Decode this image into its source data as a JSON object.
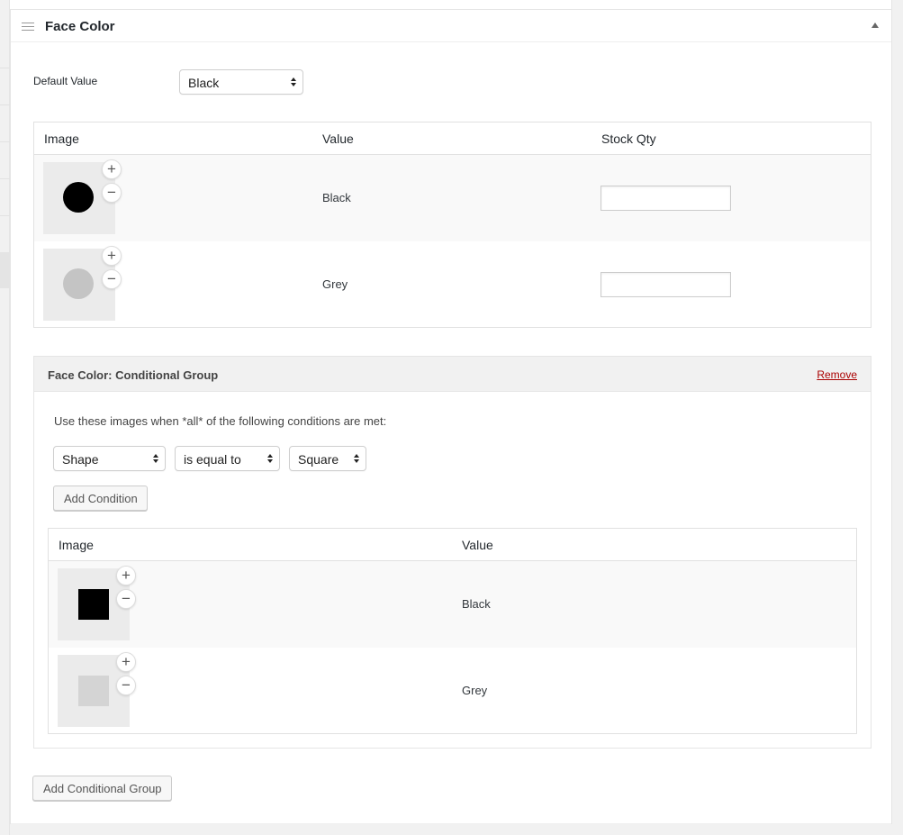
{
  "panel": {
    "title": "Face Color",
    "default_value_label": "Default Value",
    "default_value_selected": "Black"
  },
  "options_table": {
    "headers": {
      "image": "Image",
      "value": "Value",
      "stock": "Stock Qty"
    },
    "rows": [
      {
        "value": "Black",
        "stock_qty": "",
        "swatch_color": "#000000",
        "swatch_shape": "circle"
      },
      {
        "value": "Grey",
        "stock_qty": "",
        "swatch_color": "#c4c4c4",
        "swatch_shape": "circle"
      }
    ]
  },
  "group": {
    "title": "Face Color: Conditional Group",
    "remove_label": "Remove",
    "instruction": "Use these images when *all* of the following conditions are met:",
    "condition": {
      "field": "Shape",
      "operator": "is equal to",
      "value": "Square"
    },
    "add_condition_label": "Add Condition",
    "table": {
      "headers": {
        "image": "Image",
        "value": "Value"
      },
      "rows": [
        {
          "value": "Black",
          "swatch_color": "#000000",
          "swatch_shape": "square"
        },
        {
          "value": "Grey",
          "swatch_color": "#d4d4d4",
          "swatch_shape": "square"
        }
      ]
    }
  },
  "add_group_label": "Add Conditional Group",
  "icons": {
    "add": "+",
    "remove": "−",
    "toggle": "triangle-up-icon",
    "drag": "hamburger-icon"
  },
  "colors": {
    "remove_link": "#aa0000",
    "row_alt": "#f9f9f9",
    "thumb_bg": "#ebebeb"
  }
}
